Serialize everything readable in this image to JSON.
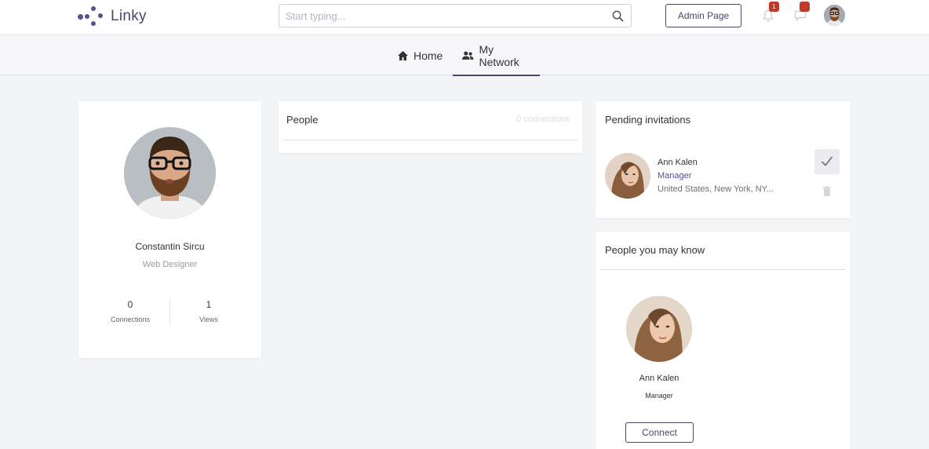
{
  "app": {
    "name": "Linky"
  },
  "header": {
    "search_placeholder": "Start typing...",
    "admin_label": "Admin Page",
    "notifications_count": "1",
    "messages_count": ""
  },
  "nav": {
    "tabs": [
      {
        "label": "Home",
        "icon": "home-icon",
        "active": false
      },
      {
        "label": "My Network",
        "icon": "people-icon",
        "active": true
      }
    ]
  },
  "profile": {
    "name": "Constantin Sircu",
    "role": "Web Designer",
    "stats": [
      {
        "value": "0",
        "label": "Connections"
      },
      {
        "value": "1",
        "label": "Views"
      }
    ]
  },
  "people": {
    "title": "People",
    "count_text": "0 connections"
  },
  "pending": {
    "title": "Pending invitations",
    "items": [
      {
        "name": "Ann Kalen",
        "role": "Manager",
        "location": "United States, New York, NY..."
      }
    ]
  },
  "suggestions": {
    "title": "People you may know",
    "items": [
      {
        "name": "Ann Kalen",
        "role": "Manager",
        "action_label": "Connect"
      }
    ]
  },
  "colors": {
    "brand": "#4d4470",
    "accent": "#5b4e8c",
    "badge": "#c0392b",
    "background": "#f3f4f6"
  }
}
